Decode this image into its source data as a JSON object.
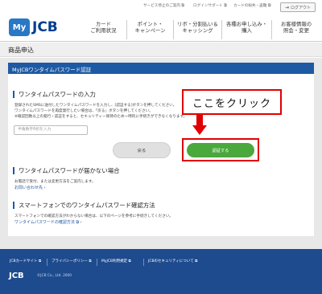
{
  "header": {
    "logo_my": "My",
    "logo_jcb": "JCB",
    "util_links": [
      "サービス停止のご案内",
      "ログインサポート",
      "カードの紛失・盗難"
    ],
    "logout_label": "ログアウト",
    "nav": [
      {
        "line1": "カード",
        "line2": "ご利用状況"
      },
      {
        "line1": "ポイント・",
        "line2": "キャンペーン"
      },
      {
        "line1": "リボ・分割払い＆",
        "line2": "キャッシング"
      },
      {
        "line1": "各種お申し込み・",
        "line2": "購入"
      },
      {
        "line1": "お客様情報の",
        "line2": "照会・変更"
      }
    ]
  },
  "page": {
    "title": "商品申込",
    "panel_title": "MyJCBワンタイムパスワード認証"
  },
  "otp_section": {
    "title": "ワンタイムパスワードの入力",
    "desc_line1": "登録されたSMSに送付したワンタイムパスワードを入力し、[認証する]ボタンを押してください。",
    "desc_line2": "ワンタイムパスワードを再度発行したい場合は、「戻る」ボタンを押してください。",
    "desc_line3": "※確認回数以上の発行・認証をすると、セキュリティー保持のため一時的に手続きができなくなります。",
    "input_placeholder": "半角数字6桁を入力",
    "back_label": "戻る",
    "auth_label": "認証する"
  },
  "annotation": {
    "callout": "ここをクリック"
  },
  "not_received_section": {
    "title": "ワンタイムパスワードが届かない場合",
    "desc": "お電話で受付、または変更方法をご案内します。",
    "link": "お問い合わせ先"
  },
  "smartphone_section": {
    "title": "スマートフォンでのワンタイムパスワード確認方法",
    "desc": "スマートフォンでの確認方法がわからない場合は、以下のページを参考に手続きしてください。",
    "link": "ワンタイムパスワードの確認方法"
  },
  "footer": {
    "links": [
      "JCBカードサイト",
      "プライバシーポリシー",
      "MyJCB利用規定",
      "JCBのセキュリティについて"
    ],
    "logo": "JCB",
    "copyright": "©JCB Co., Ltd. 2000"
  },
  "colors": {
    "brand_blue": "#1e5aa3",
    "footer_blue": "#1e4b8e",
    "auth_green": "#4aa83d",
    "annotation_red": "#e00000"
  }
}
